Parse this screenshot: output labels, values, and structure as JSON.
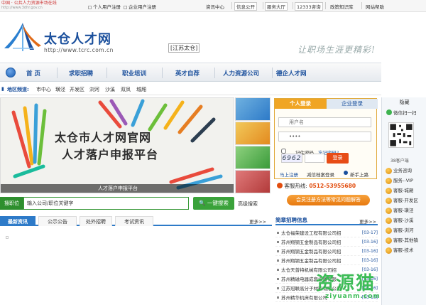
{
  "topbar": {
    "site_line1": "中国 · 公共人力资源市场在线",
    "site_line2": "http://www.3dhr.gov.cn",
    "personal_register": "个人用户注册",
    "company_register": "企业用户注册",
    "links": [
      "资讯中心",
      "信息公开",
      "服务大厅",
      "12333咨询",
      "政策知识库",
      "网站帮助"
    ]
  },
  "header": {
    "logo_title": "太仓人才网",
    "logo_url": "http://www.tcrc.com.cn",
    "city": "[江苏太仓]",
    "slogan": "让职场生涯更精彩!"
  },
  "nav": {
    "items": [
      "首 页",
      "求职招聘",
      "职业培训",
      "英才自荐",
      "人力资源公司",
      "德企人才网"
    ]
  },
  "area": {
    "label": "地区频道:",
    "items": [
      "市中心",
      "璜泾",
      "开发区",
      "浏河",
      "沙溪",
      "双凤",
      "城厢"
    ]
  },
  "banner": {
    "title_line1": "太仓市人才网官网",
    "title_line2": "人才落户申报平台",
    "caption": "人才落户申报平台"
  },
  "login": {
    "tab_personal": "个人登录",
    "tab_company": "企业登录",
    "username_placeholder": "用户名",
    "password_value": "••••",
    "remember": "记住密码",
    "forgot": "忘记密码?",
    "captcha": "6962",
    "login_button": "登录",
    "register": "马上注册",
    "reset_guide": "减信档案登录",
    "novice": "新手上路",
    "hotline_label": "客服热线:",
    "hotline_number": "0512-53955680",
    "faq_button": "会员注册方法等常见问题解答"
  },
  "search": {
    "label": "搜职位",
    "placeholder": "输入公司/职位关键字",
    "button": "一键搜索",
    "advanced": "高级搜索"
  },
  "news_tabs": {
    "items": [
      "最新资讯",
      "公示公告",
      "处外招聘",
      "考试资讯"
    ],
    "more": "更多>>"
  },
  "recruit": {
    "title": "简章招聘信息",
    "more": "更多>>",
    "rows": [
      {
        "company": "太仓福荣建设工程有限公司招",
        "date": "[03-17]"
      },
      {
        "company": "苏州翔钢五金制品有限公司招",
        "date": "[03-16]"
      },
      {
        "company": "苏州翔钢五金制品有限公司招",
        "date": "[03-16]"
      },
      {
        "company": "苏州翔钢五金制品有限公司招",
        "date": "[03-16]"
      },
      {
        "company": "太仓天普特机械有限公司招",
        "date": "[03-16]"
      },
      {
        "company": "苏州精磁电器成套设备有限",
        "date": "[03-16]"
      },
      {
        "company": "江苏冠联高分子材料有限公司",
        "date": "[03-16]"
      },
      {
        "company": "苏州精华机床有限公司",
        "date": "[03-15]"
      }
    ]
  },
  "side": {
    "hide": "隐藏",
    "scan": "微信扫一扫",
    "code_label": "38客户端",
    "services": [
      "业务咨询",
      "服务--VIP",
      "客服-城厢",
      "客服-开发区",
      "客服-璜泾",
      "客服-沙溪",
      "客服-浏河",
      "客服-其他镇",
      "客服-技术"
    ]
  },
  "watermark": {
    "text": "资源猫",
    "sub": "ziyuanm.com"
  }
}
